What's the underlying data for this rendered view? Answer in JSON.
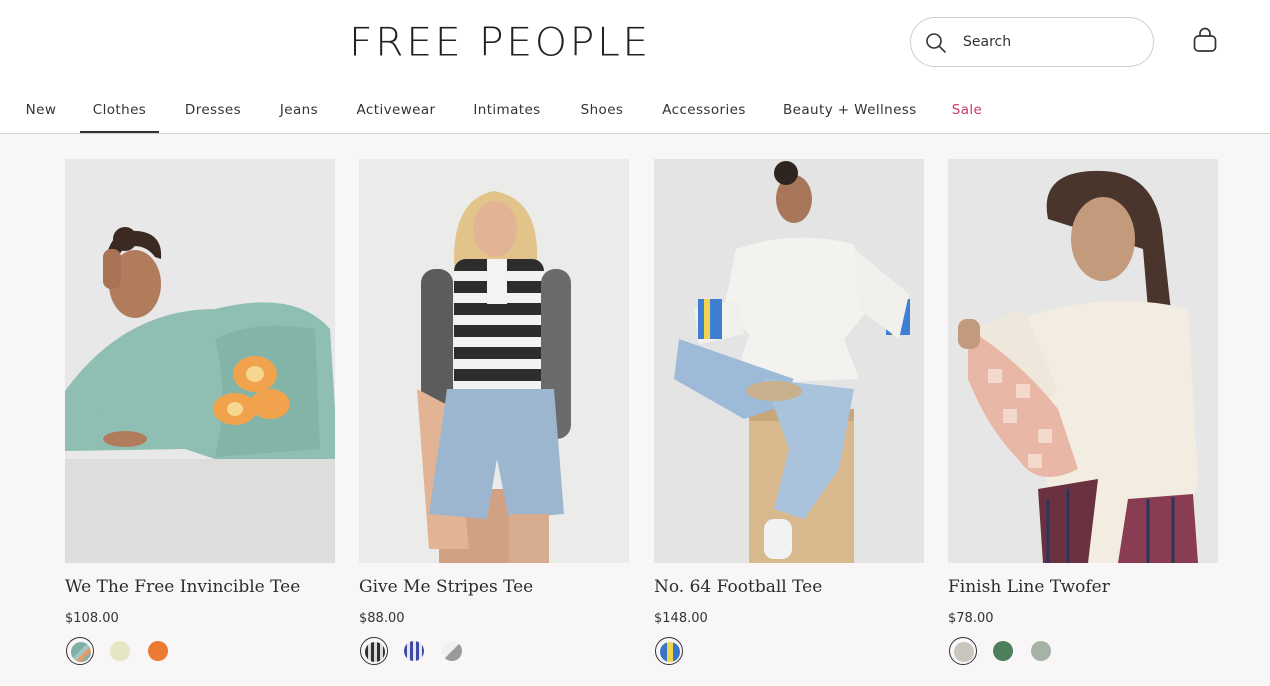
{
  "brand": {
    "logo_text": "FREE PEOPLE"
  },
  "search": {
    "placeholder": "Search"
  },
  "icons": {
    "search": "search-icon",
    "bag": "shopping-bag-icon"
  },
  "nav": {
    "items": [
      {
        "label": "New",
        "active": false
      },
      {
        "label": "Clothes",
        "active": true
      },
      {
        "label": "Dresses",
        "active": false
      },
      {
        "label": "Jeans",
        "active": false
      },
      {
        "label": "Activewear",
        "active": false
      },
      {
        "label": "Intimates",
        "active": false
      },
      {
        "label": "Shoes",
        "active": false
      },
      {
        "label": "Accessories",
        "active": false
      },
      {
        "label": "Beauty + Wellness",
        "active": false
      },
      {
        "label": "Sale",
        "active": false
      }
    ],
    "sale_color": "#c43d68"
  },
  "products": [
    {
      "name": "We The Free Invincible Tee",
      "price": "$108.00",
      "image": "model-in-mint-floral-tee",
      "swatches": [
        {
          "name": "mint-floral",
          "colors": [
            "#7fb0a8",
            "#a6c6c2"
          ],
          "selected": true
        },
        {
          "name": "cream",
          "colors": [
            "#e5e7c2"
          ],
          "selected": false
        },
        {
          "name": "orange",
          "colors": [
            "#ec7a33"
          ],
          "selected": false
        }
      ]
    },
    {
      "name": "Give Me Stripes Tee",
      "price": "$88.00",
      "image": "model-in-striped-tee",
      "swatches": [
        {
          "name": "black-stripe",
          "colors": [
            "#2f2f2f",
            "#d9d9d9"
          ],
          "selected": true
        },
        {
          "name": "blue-stripe",
          "colors": [
            "#3e4aa2",
            "#e6e6f2"
          ],
          "selected": false
        },
        {
          "name": "grey-combo",
          "colors": [
            "#9a9a9a",
            "#f0f0f0"
          ],
          "selected": false
        }
      ]
    },
    {
      "name": "No. 64 Football Tee",
      "price": "$148.00",
      "image": "model-in-football-tee",
      "swatches": [
        {
          "name": "blue-yellow",
          "colors": [
            "#3a74c9",
            "#f1d44a"
          ],
          "selected": true
        }
      ]
    },
    {
      "name": "Finish Line Twofer",
      "price": "$78.00",
      "image": "model-in-twofer-top",
      "swatches": [
        {
          "name": "ivory",
          "colors": [
            "#c9c7bd"
          ],
          "selected": true
        },
        {
          "name": "green",
          "colors": [
            "#4e7f5c"
          ],
          "selected": false
        },
        {
          "name": "sage",
          "colors": [
            "#a7b2a6"
          ],
          "selected": false
        }
      ]
    }
  ]
}
